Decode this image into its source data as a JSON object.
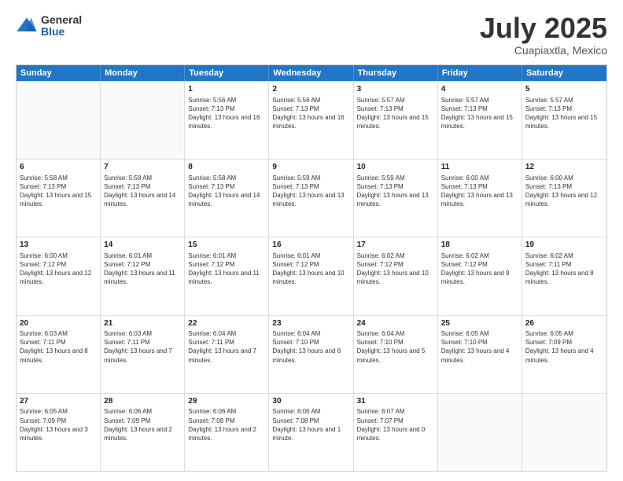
{
  "header": {
    "logo": {
      "line1": "General",
      "line2": "Blue"
    },
    "title": "July 2025",
    "subtitle": "Cuapiaxtla, Mexico"
  },
  "calendar": {
    "days": [
      "Sunday",
      "Monday",
      "Tuesday",
      "Wednesday",
      "Thursday",
      "Friday",
      "Saturday"
    ],
    "rows": [
      [
        {
          "day": "",
          "empty": true
        },
        {
          "day": "",
          "empty": true
        },
        {
          "day": "1",
          "sunrise": "5:56 AM",
          "sunset": "7:13 PM",
          "daylight": "13 hours and 16 minutes."
        },
        {
          "day": "2",
          "sunrise": "5:56 AM",
          "sunset": "7:13 PM",
          "daylight": "13 hours and 16 minutes."
        },
        {
          "day": "3",
          "sunrise": "5:57 AM",
          "sunset": "7:13 PM",
          "daylight": "13 hours and 15 minutes."
        },
        {
          "day": "4",
          "sunrise": "5:57 AM",
          "sunset": "7:13 PM",
          "daylight": "13 hours and 15 minutes."
        },
        {
          "day": "5",
          "sunrise": "5:57 AM",
          "sunset": "7:13 PM",
          "daylight": "13 hours and 15 minutes."
        }
      ],
      [
        {
          "day": "6",
          "sunrise": "5:58 AM",
          "sunset": "7:13 PM",
          "daylight": "13 hours and 15 minutes."
        },
        {
          "day": "7",
          "sunrise": "5:58 AM",
          "sunset": "7:13 PM",
          "daylight": "13 hours and 14 minutes."
        },
        {
          "day": "8",
          "sunrise": "5:58 AM",
          "sunset": "7:13 PM",
          "daylight": "13 hours and 14 minutes."
        },
        {
          "day": "9",
          "sunrise": "5:59 AM",
          "sunset": "7:13 PM",
          "daylight": "13 hours and 13 minutes."
        },
        {
          "day": "10",
          "sunrise": "5:59 AM",
          "sunset": "7:13 PM",
          "daylight": "13 hours and 13 minutes."
        },
        {
          "day": "11",
          "sunrise": "6:00 AM",
          "sunset": "7:13 PM",
          "daylight": "13 hours and 13 minutes."
        },
        {
          "day": "12",
          "sunrise": "6:00 AM",
          "sunset": "7:13 PM",
          "daylight": "13 hours and 12 minutes."
        }
      ],
      [
        {
          "day": "13",
          "sunrise": "6:00 AM",
          "sunset": "7:12 PM",
          "daylight": "13 hours and 12 minutes."
        },
        {
          "day": "14",
          "sunrise": "6:01 AM",
          "sunset": "7:12 PM",
          "daylight": "13 hours and 11 minutes."
        },
        {
          "day": "15",
          "sunrise": "6:01 AM",
          "sunset": "7:12 PM",
          "daylight": "13 hours and 11 minutes."
        },
        {
          "day": "16",
          "sunrise": "6:01 AM",
          "sunset": "7:12 PM",
          "daylight": "13 hours and 10 minutes."
        },
        {
          "day": "17",
          "sunrise": "6:02 AM",
          "sunset": "7:12 PM",
          "daylight": "13 hours and 10 minutes."
        },
        {
          "day": "18",
          "sunrise": "6:02 AM",
          "sunset": "7:12 PM",
          "daylight": "13 hours and 9 minutes."
        },
        {
          "day": "19",
          "sunrise": "6:02 AM",
          "sunset": "7:11 PM",
          "daylight": "13 hours and 8 minutes."
        }
      ],
      [
        {
          "day": "20",
          "sunrise": "6:03 AM",
          "sunset": "7:11 PM",
          "daylight": "13 hours and 8 minutes."
        },
        {
          "day": "21",
          "sunrise": "6:03 AM",
          "sunset": "7:11 PM",
          "daylight": "13 hours and 7 minutes."
        },
        {
          "day": "22",
          "sunrise": "6:04 AM",
          "sunset": "7:11 PM",
          "daylight": "13 hours and 7 minutes."
        },
        {
          "day": "23",
          "sunrise": "6:04 AM",
          "sunset": "7:10 PM",
          "daylight": "13 hours and 6 minutes."
        },
        {
          "day": "24",
          "sunrise": "6:04 AM",
          "sunset": "7:10 PM",
          "daylight": "13 hours and 5 minutes."
        },
        {
          "day": "25",
          "sunrise": "6:05 AM",
          "sunset": "7:10 PM",
          "daylight": "13 hours and 4 minutes."
        },
        {
          "day": "26",
          "sunrise": "6:05 AM",
          "sunset": "7:09 PM",
          "daylight": "13 hours and 4 minutes."
        }
      ],
      [
        {
          "day": "27",
          "sunrise": "6:05 AM",
          "sunset": "7:09 PM",
          "daylight": "13 hours and 3 minutes."
        },
        {
          "day": "28",
          "sunrise": "6:06 AM",
          "sunset": "7:09 PM",
          "daylight": "13 hours and 2 minutes."
        },
        {
          "day": "29",
          "sunrise": "6:06 AM",
          "sunset": "7:08 PM",
          "daylight": "13 hours and 2 minutes."
        },
        {
          "day": "30",
          "sunrise": "6:06 AM",
          "sunset": "7:08 PM",
          "daylight": "13 hours and 1 minute."
        },
        {
          "day": "31",
          "sunrise": "6:07 AM",
          "sunset": "7:07 PM",
          "daylight": "13 hours and 0 minutes."
        },
        {
          "day": "",
          "empty": true
        },
        {
          "day": "",
          "empty": true
        }
      ]
    ]
  }
}
